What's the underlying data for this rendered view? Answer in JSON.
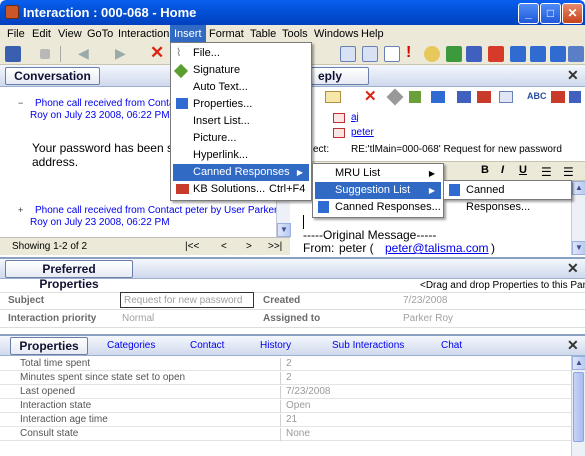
{
  "window": {
    "title": "Interaction : 000-068 - Home",
    "minimize": "_",
    "maximize": "□",
    "close": "✕"
  },
  "menubar": [
    "File",
    "Edit",
    "View",
    "GoTo",
    "Interaction",
    "Insert",
    "Format",
    "Table",
    "Tools",
    "Windows",
    "Help"
  ],
  "conversation": {
    "tab": "Conversation",
    "items": [
      {
        "toggle": "−",
        "link_line1": "Phone call received from Contact",
        "link_line2": "Roy on July 23 2008, 06:22 PM",
        "body_line1": "Your password has been s",
        "body_line2": "address."
      },
      {
        "toggle": "+",
        "link_line1": "Phone call received from Contact peter by User Parker",
        "link_line2": "Roy on July 23 2008, 06:22 PM"
      }
    ],
    "showing": "Showing 1-2 of 2",
    "nav": [
      "|<<",
      "<",
      ">",
      ">>|"
    ]
  },
  "reply": {
    "tab_partial": "eply",
    "to_1": "aj",
    "to_2": "peter",
    "subject_label": "ect:",
    "subject_value": "RE:'tlMain=000-068' Request for new password",
    "format_buttons": [
      "B",
      "I",
      "U"
    ],
    "original_message": "-----Original Message-----",
    "from_label": "From:",
    "from_name": "peter (",
    "from_email": "peter@talisma.com",
    "from_close": ")"
  },
  "preferred": {
    "tab": "Preferred Properties",
    "hint": "<Drag and drop Properties to this Pane>",
    "fields": [
      {
        "label": "Subject",
        "value": "Request for new password"
      },
      {
        "label": "Created",
        "value": "7/23/2008"
      },
      {
        "label": "Interaction priority",
        "value": "Normal"
      },
      {
        "label": "Assigned to",
        "value": "Parker Roy"
      }
    ]
  },
  "properties": {
    "tab": "Properties",
    "tabs": [
      "Categories",
      "Contact",
      "History",
      "Sub Interactions",
      "Chat"
    ],
    "rows": [
      {
        "name": "Total time spent",
        "value": "2"
      },
      {
        "name": "Minutes spent since state set to open",
        "value": "2"
      },
      {
        "name": "Last opened",
        "value": "7/23/2008"
      },
      {
        "name": "Interaction state",
        "value": "Open"
      },
      {
        "name": "Interaction age time",
        "value": "21"
      },
      {
        "name": "Consult state",
        "value": "None"
      }
    ]
  },
  "insert_menu": [
    {
      "label": "File...",
      "icon": "paperclip-icon"
    },
    {
      "label": "Signature",
      "icon": "pen-icon"
    },
    {
      "label": "Auto Text...",
      "icon": ""
    },
    {
      "label": "Properties...",
      "icon": "properties-icon"
    },
    {
      "label": "Insert List...",
      "icon": ""
    },
    {
      "label": "Picture...",
      "icon": ""
    },
    {
      "label": "Hyperlink...",
      "icon": ""
    },
    {
      "label": "Canned Responses",
      "icon": "",
      "submenu": true,
      "highlighted": true
    },
    {
      "label": "KB Solutions...",
      "icon": "book-icon",
      "shortcut": "Ctrl+F4"
    }
  ],
  "canned_submenu": [
    {
      "label": "MRU List",
      "submenu": true
    },
    {
      "label": "Suggestion List",
      "submenu": true,
      "highlighted": true
    },
    {
      "label": "Canned Responses...",
      "icon": "canned-icon"
    }
  ],
  "suggestion_submenu": [
    {
      "label": "Canned Responses...",
      "icon": "canned-icon"
    }
  ]
}
